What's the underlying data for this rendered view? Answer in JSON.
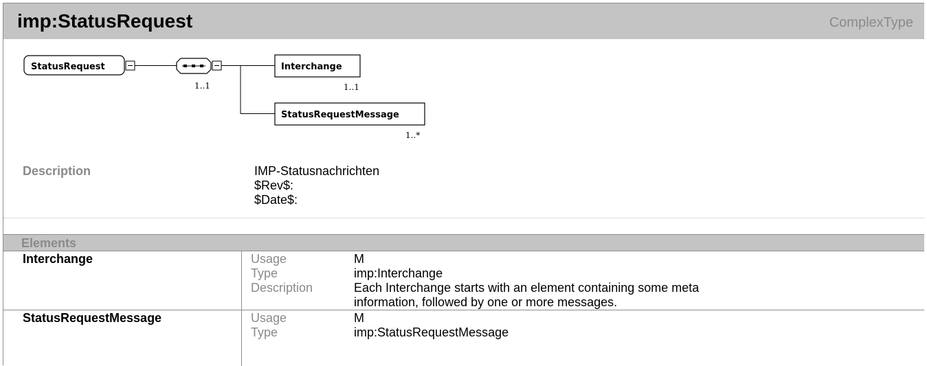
{
  "header": {
    "title": "imp:StatusRequest",
    "kind": "ComplexType"
  },
  "diagram": {
    "root_label": "StatusRequest",
    "root_toggle": "−",
    "sequence_toggle": "−",
    "sequence_occurs": "1..1",
    "children": [
      {
        "label": "Interchange",
        "occurs": "1..1"
      },
      {
        "label": "StatusRequestMessage",
        "occurs": "1..*"
      }
    ]
  },
  "description": {
    "label": "Description",
    "lines": [
      "IMP-Statusnachrichten",
      "$Rev$:",
      "$Date$:"
    ]
  },
  "elements": {
    "header": "Elements",
    "rows": [
      {
        "name": "Interchange",
        "props": [
          {
            "key": "Usage",
            "value": "M"
          },
          {
            "key": "Type",
            "value": "imp:Interchange"
          },
          {
            "key": "Description",
            "value_lines": [
              "Each Interchange starts with an element containing some meta",
              "information, followed by one or more messages."
            ]
          }
        ]
      },
      {
        "name": "StatusRequestMessage",
        "props": [
          {
            "key": "Usage",
            "value": "M"
          },
          {
            "key": "Type",
            "value": "imp:StatusRequestMessage"
          }
        ]
      }
    ]
  }
}
